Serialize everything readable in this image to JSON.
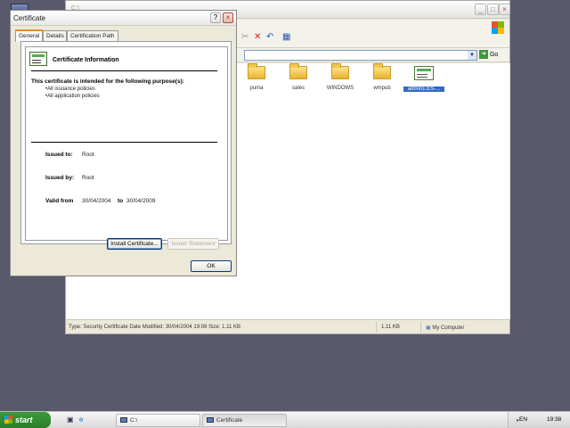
{
  "explorer": {
    "go_label": "Go",
    "files": [
      {
        "name": "puma",
        "type": "folder"
      },
      {
        "name": "sales",
        "type": "folder"
      },
      {
        "name": "WINDOWS",
        "type": "folder"
      },
      {
        "name": "wmpub",
        "type": "folder"
      },
      {
        "name": "admin1.ES-...",
        "type": "certificate"
      }
    ],
    "status": {
      "details": "Type: Security Certificate Date Modified: 30/04/2004 19:08 Size: 1.11 KB",
      "size": "1.11 KB",
      "zone": "My Computer"
    }
  },
  "dialog": {
    "title": "Certificate",
    "help_label": "?",
    "close_label": "×",
    "tabs": [
      "General",
      "Details",
      "Certification Path"
    ],
    "info_heading": "Certificate Information",
    "purpose_heading": "This certificate is intended for the following purpose(s):",
    "purposes": [
      "•All issuance policies",
      "•All application policies"
    ],
    "issued_to_label": "Issued to:",
    "issued_to": "Root",
    "issued_by_label": "Issued by:",
    "issued_by": "Root",
    "valid_from_label": "Valid from",
    "valid_from": "30/04/2004",
    "valid_to_label": "to",
    "valid_to": "30/04/2009",
    "install_button": "Install Certificate...",
    "issuer_button": "Issuer Statement",
    "ok_button": "OK"
  },
  "taskbar": {
    "start_label": "start",
    "tasks": [
      "C:\\",
      "Certificate"
    ],
    "language": "EN",
    "clock": "19:38"
  },
  "colors": {
    "desktop": "#58596b",
    "selection": "#316ac5",
    "start_green": "#2a7e2a"
  }
}
